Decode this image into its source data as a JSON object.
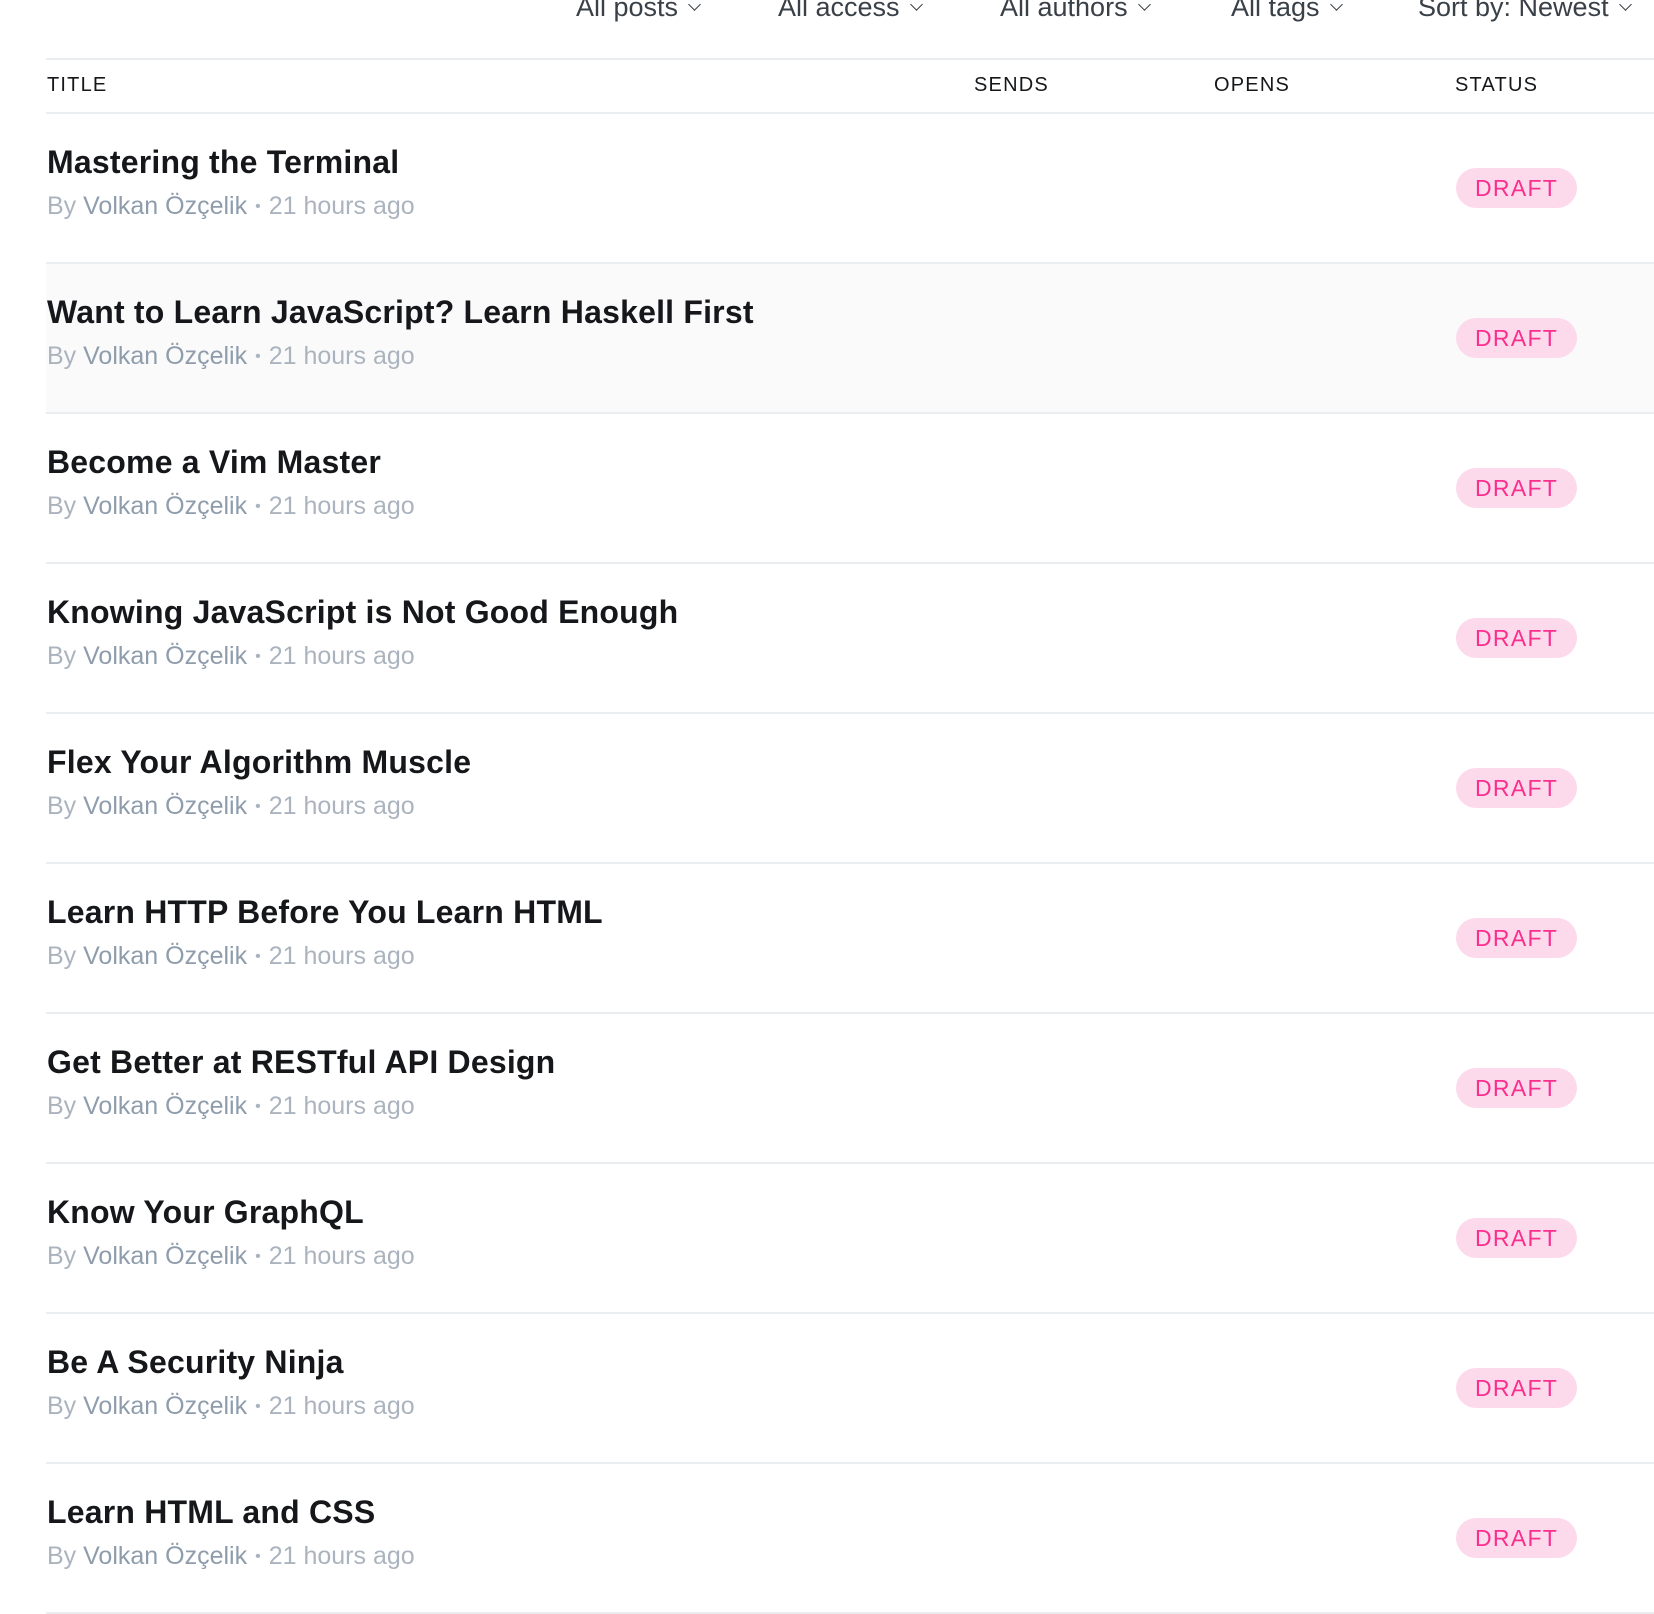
{
  "filters": {
    "type": "All posts",
    "access": "All access",
    "authors": "All authors",
    "tags": "All tags",
    "sort": "Sort by: Newest"
  },
  "columns": {
    "title": "TITLE",
    "sends": "SENDS",
    "opens": "OPENS",
    "status": "STATUS"
  },
  "meta_prefix": "By",
  "meta_separator": "•",
  "posts": [
    {
      "title": "Mastering the Terminal",
      "author": "Volkan Özçelik",
      "time": "21 hours ago",
      "status": "DRAFT"
    },
    {
      "title": "Want to Learn JavaScript? Learn Haskell First",
      "author": "Volkan Özçelik",
      "time": "21 hours ago",
      "status": "DRAFT"
    },
    {
      "title": "Become a Vim Master",
      "author": "Volkan Özçelik",
      "time": "21 hours ago",
      "status": "DRAFT"
    },
    {
      "title": "Knowing JavaScript is Not Good Enough",
      "author": "Volkan Özçelik",
      "time": "21 hours ago",
      "status": "DRAFT"
    },
    {
      "title": "Flex Your Algorithm Muscle",
      "author": "Volkan Özçelik",
      "time": "21 hours ago",
      "status": "DRAFT"
    },
    {
      "title": "Learn HTTP Before You Learn HTML",
      "author": "Volkan Özçelik",
      "time": "21 hours ago",
      "status": "DRAFT"
    },
    {
      "title": "Get Better at RESTful API Design",
      "author": "Volkan Özçelik",
      "time": "21 hours ago",
      "status": "DRAFT"
    },
    {
      "title": "Know Your GraphQL",
      "author": "Volkan Özçelik",
      "time": "21 hours ago",
      "status": "DRAFT"
    },
    {
      "title": "Be A Security Ninja",
      "author": "Volkan Özçelik",
      "time": "21 hours ago",
      "status": "DRAFT"
    },
    {
      "title": "Learn HTML and CSS",
      "author": "Volkan Özçelik",
      "time": "21 hours ago",
      "status": "DRAFT"
    }
  ],
  "colors": {
    "draft_text": "#fb2d8d",
    "draft_bg": "#fdd9ec",
    "meta_text": "#abb4be",
    "author_text": "#8e9cac",
    "divider": "#ebeef0"
  }
}
